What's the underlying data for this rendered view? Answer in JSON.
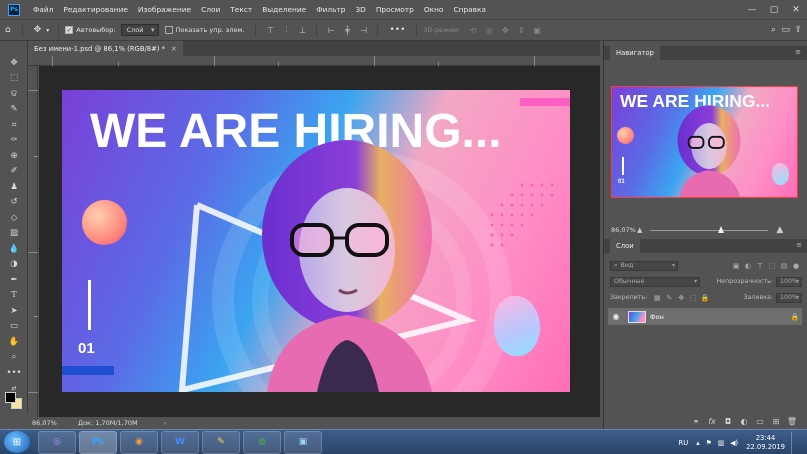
{
  "app": {
    "logo": "Ps",
    "menu": [
      "Файл",
      "Редактирование",
      "Изображение",
      "Слои",
      "Текст",
      "Выделение",
      "Фильтр",
      "3D",
      "Просмотр",
      "Окно",
      "Справка"
    ],
    "window_controls": [
      "minimize-icon",
      "maximize-icon",
      "close-icon"
    ]
  },
  "options": {
    "autoselect_label": "Автовыбор:",
    "autoselect_checked": true,
    "autoselect_value": "Слой",
    "show_transform_label": "Показать упр. элем.",
    "show_transform_checked": false,
    "mode_3d_label": "3D-режим:"
  },
  "document": {
    "tab_title": "Без имени-1.psd @ 86,1% (RGB/8#) *",
    "headline": "WE ARE HIRING...",
    "number": "01"
  },
  "status": {
    "zoom": "86,07%",
    "doc_info": "Док: 1,70M/1,70M"
  },
  "navigator": {
    "title": "Навигатор",
    "zoom": "86,07%",
    "headline": "WE ARE HIRING...",
    "number": "01",
    "slider_fraction": 0.6
  },
  "layers": {
    "title": "Слои",
    "filter_kind": "Вид",
    "blend_mode": "Обычные",
    "opacity_label": "Непрозрачность:",
    "opacity_value": "100%",
    "lock_label": "Закрепить:",
    "fill_label": "Заливка:",
    "fill_value": "100%",
    "items": [
      {
        "name": "Фон",
        "visible": true,
        "locked": true
      }
    ]
  },
  "taskbar": {
    "apps": [
      "viber",
      "Ps",
      "firefox",
      "W",
      "paint",
      "chrome",
      "photo-viewer"
    ],
    "active": "Ps",
    "lang": "RU",
    "time": "23:44",
    "date": "22.09.2019"
  },
  "colors": {
    "accent": "#31a8ff",
    "nav_frame": "#ff3b3b",
    "panel_bg": "#535353"
  }
}
